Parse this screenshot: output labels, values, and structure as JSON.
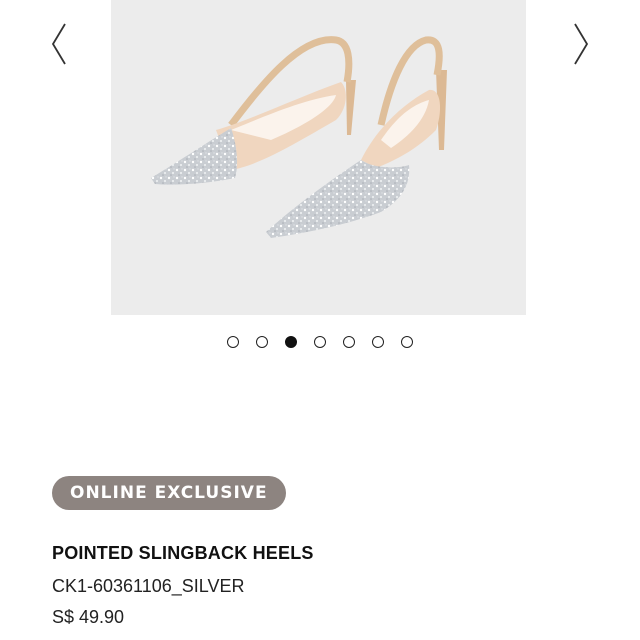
{
  "gallery": {
    "prev_icon": "chevron-left-icon",
    "next_icon": "chevron-right-icon",
    "image_subject": "silver glitter pointed slingback heels",
    "slide_count": 7,
    "active_slide": 3
  },
  "badge": {
    "label": "ONLINE EXCLUSIVE",
    "color": "#8d8480"
  },
  "product": {
    "name": "POINTED SLINGBACK HEELS",
    "sku": "CK1-60361106_SILVER",
    "price": "S$ 49.90"
  }
}
